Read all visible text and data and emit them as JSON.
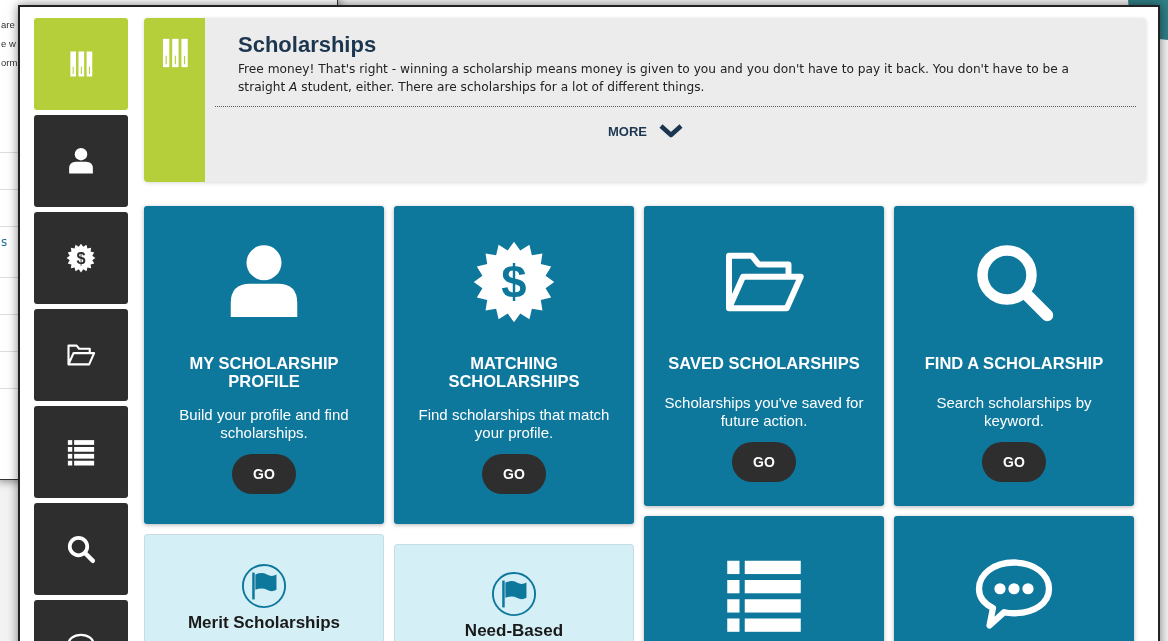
{
  "background_window": {
    "lines": [
      "are",
      "e w",
      "orm"
    ],
    "link": "s"
  },
  "sidebar": {
    "items": [
      {
        "kind": "books",
        "selected": true
      },
      {
        "kind": "person",
        "selected": false
      },
      {
        "kind": "badge",
        "glyph": "$",
        "selected": false
      },
      {
        "kind": "folder",
        "selected": false
      },
      {
        "kind": "list",
        "selected": false
      },
      {
        "kind": "search",
        "selected": false
      },
      {
        "kind": "chat",
        "selected": false
      }
    ]
  },
  "header": {
    "title": "Scholarships",
    "description": "Free money! That's right - winning a scholarship means money is given to you and you don't have to pay it back. You don't have to be a straight *A* student, either. There are scholarships for a lot of different things.",
    "more": "MORE"
  },
  "columns": [
    [
      {
        "kind": "person",
        "title": "MY SCHOLARSHIP PROFILE",
        "description": "Build your profile and find scholarships.",
        "button": "GO"
      },
      {
        "kind": "flag",
        "title": "Merit Scholarships"
      }
    ],
    [
      {
        "kind": "badge",
        "glyph": "$",
        "title": "MATCHING SCHOLARSHIPS",
        "description": "Find scholarships that match your profile.",
        "button": "GO"
      },
      {
        "kind": "flag",
        "title": "Need-Based"
      }
    ],
    [
      {
        "kind": "folder",
        "title": "SAVED SCHOLARSHIPS",
        "description": "Scholarships you've saved for future action.",
        "button": "GO"
      },
      {
        "kind": "list"
      }
    ],
    [
      {
        "kind": "search",
        "title": "FIND A SCHOLARSHIP",
        "description": "Search scholarships by keyword.",
        "button": "GO"
      },
      {
        "kind": "chat"
      }
    ]
  ]
}
